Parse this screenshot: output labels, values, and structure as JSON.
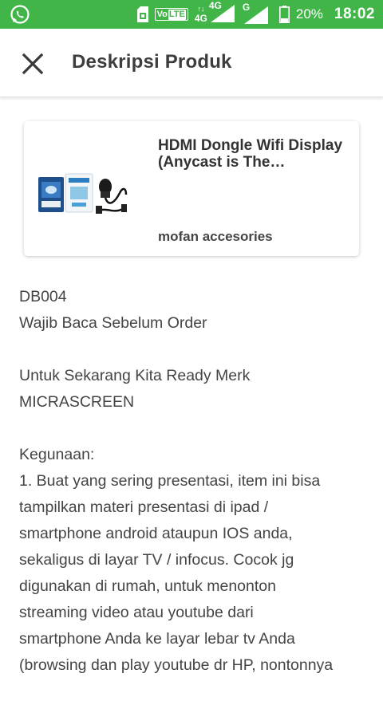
{
  "status_bar": {
    "volte_label": "Vo",
    "lte_label": "LTE",
    "net_4g_primary": "4G",
    "net_4g_secondary": "4G",
    "net_g": "G",
    "battery_percent": "20%",
    "time": "18:02",
    "background_color": "#42b549"
  },
  "app_bar": {
    "title": "Deskripsi Produk",
    "close_icon": "close-icon"
  },
  "product": {
    "name": "HDMI Dongle Wifi Display (Anycast is The…",
    "shop": "mofan accesories"
  },
  "description": {
    "paragraphs": [
      {
        "lines": [
          "DB004",
          "Wajib Baca Sebelum Order"
        ]
      },
      {
        "lines": [
          "Untuk Sekarang Kita Ready Merk",
          "MICRASCREEN"
        ]
      },
      {
        "lines": [
          "Kegunaan:",
          "1. Buat yang sering presentasi, item ini bisa",
          "tampilkan materi presentasi di ipad /",
          "smartphone android ataupun IOS anda,",
          "sekaligus di layar TV / infocus. Cocok jg",
          "digunakan di rumah, untuk menonton",
          "streaming video atau youtube dari",
          "smartphone Anda ke layar lebar tv Anda",
          "(browsing dan play youtube dr HP, nontonnya"
        ]
      }
    ]
  }
}
